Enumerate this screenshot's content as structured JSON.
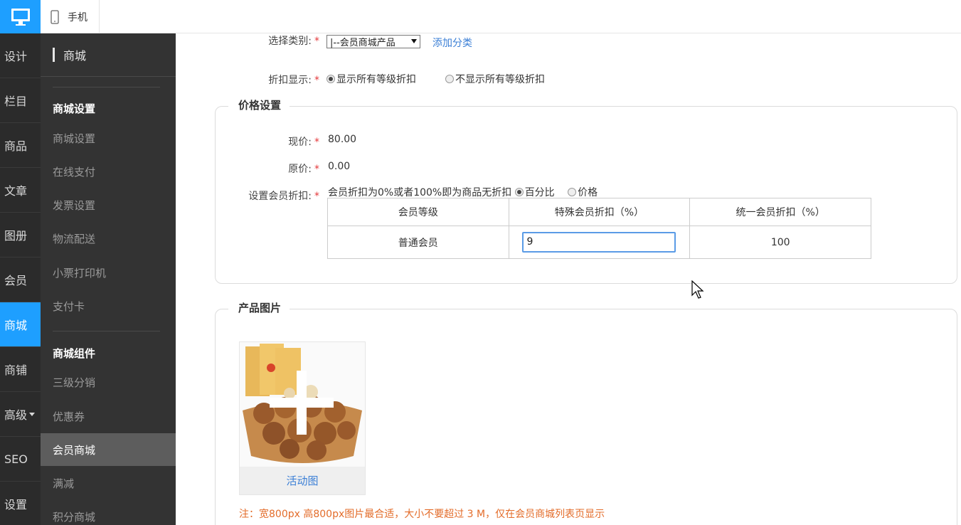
{
  "topbar": {
    "desktop_icon": "monitor-icon",
    "mobile_icon": "phone-icon",
    "mobile_label": "手机"
  },
  "nav1": {
    "items": [
      "设计",
      "栏目",
      "商品",
      "文章",
      "图册",
      "会员",
      "商城",
      "商铺",
      "高级",
      "SEO",
      "设置"
    ],
    "active": "商城"
  },
  "nav2": {
    "title": "商城",
    "group1": "商城设置",
    "group1_items": [
      "商城设置",
      "在线支付",
      "发票设置",
      "物流配送",
      "小票打印机",
      "支付卡"
    ],
    "group2": "商城组件",
    "group2_items": [
      "三级分销",
      "优惠券",
      "会员商城",
      "满减",
      "积分商城"
    ],
    "active": "会员商城"
  },
  "form": {
    "category_label": "选择类别:",
    "category_value": "|--会员商城产品",
    "add_category": "添加分类",
    "discount_label": "折扣显示:",
    "discount_opt1": "显示所有等级折扣",
    "discount_opt2": "不显示所有等级折扣",
    "required_mark": "*"
  },
  "price": {
    "legend": "价格设置",
    "current_label": "现价:",
    "current_value": "80.00",
    "original_label": "原价:",
    "original_value": "0.00",
    "member_label": "设置会员折扣:",
    "member_hint": "会员折扣为0%或者100%即为商品无折扣",
    "mode_percent": "百分比",
    "mode_price": "价格",
    "table": {
      "headers": [
        "会员等级",
        "特殊会员折扣（%）",
        "统一会员折扣（%）"
      ],
      "row": {
        "level": "普通会员",
        "special": "9",
        "uniform": "100"
      }
    }
  },
  "image": {
    "legend": "产品图片",
    "caption": "活动图",
    "note": "注：宽800px 高800px图片最合适，大小不要超过 3 M，仅在会员商城列表页显示"
  },
  "colors": {
    "accent": "#1e9fff",
    "link": "#3b7fd6",
    "note": "#e36c2a",
    "required": "#e4393c"
  }
}
